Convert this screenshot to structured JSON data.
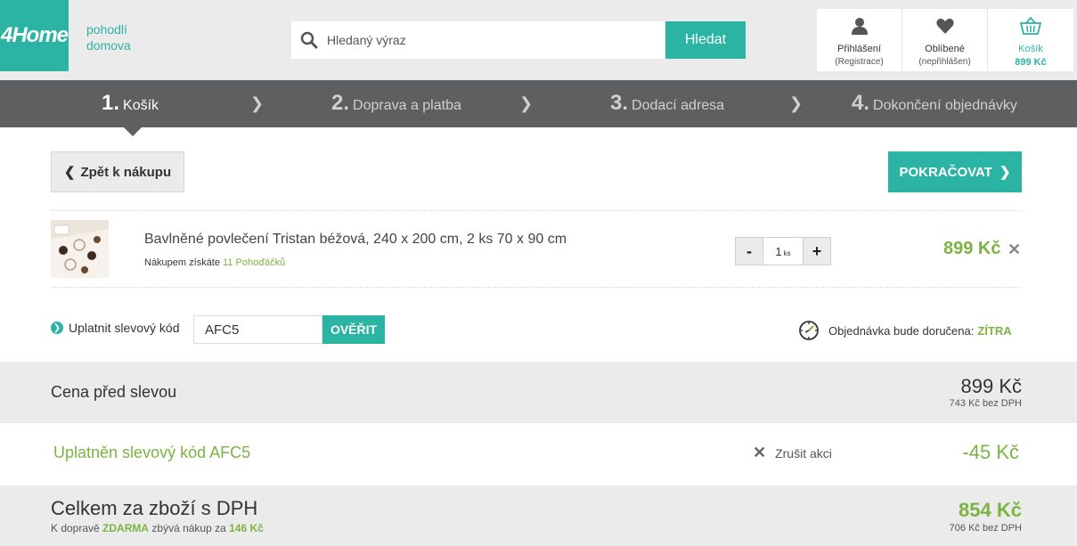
{
  "header": {
    "logo": "4Home",
    "tagline_line1": "pohodlí",
    "tagline_line2": "domova",
    "search_placeholder": "Hledaný výraz",
    "search_button": "Hledat",
    "login_label": "Přihlášení",
    "login_sub": "(Registrace)",
    "favorites_label": "Oblíbené",
    "favorites_sub": "(nepřihlášen)",
    "cart_label": "Košík",
    "cart_total": "899 Kč"
  },
  "steps": [
    {
      "num": "1.",
      "label": "Košík"
    },
    {
      "num": "2.",
      "label": "Doprava a platba"
    },
    {
      "num": "3.",
      "label": "Dodací adresa"
    },
    {
      "num": "4.",
      "label": "Dokončení objednávky"
    }
  ],
  "actions": {
    "back_label": "Zpět k nákupu",
    "continue_label": "POKRAČOVAT"
  },
  "product": {
    "name": "Bavlněné povlečení Tristan béžová, 240 x 200 cm, 2 ks 70 x 90 cm",
    "points_prefix": "Nákupem získáte",
    "points_value": "11 Pohoďáčků",
    "qty_minus": "-",
    "qty_value": "1",
    "qty_unit": "ks",
    "qty_plus": "+",
    "price": "899 Kč"
  },
  "discount": {
    "label": "Uplatnit slevový kód",
    "code": "AFC5",
    "verify_label": "OVĚŘIT",
    "delivery_text": "Objednávka bude doručena:",
    "delivery_when": "ZÍTRA"
  },
  "summary": {
    "before_label": "Cena před slevou",
    "before_value": "899 Kč",
    "before_sub": "743 Kč bez DPH",
    "applied_label": "Uplatněn slevový kód AFC5",
    "cancel_label": "Zrušit akci",
    "applied_value": "-45 Kč",
    "total_label": "Celkem za zboží s DPH",
    "total_value": "854 Kč",
    "total_sub": "706 Kč bez DPH",
    "note_prefix": "K dopravě",
    "note_free": "ZDARMA",
    "note_mid": "zbývá nákup za",
    "note_amount": "146 Kč"
  },
  "colors": {
    "accent": "#2bb3a3",
    "green": "#7cb342",
    "steps_bg": "#5d5f61"
  }
}
